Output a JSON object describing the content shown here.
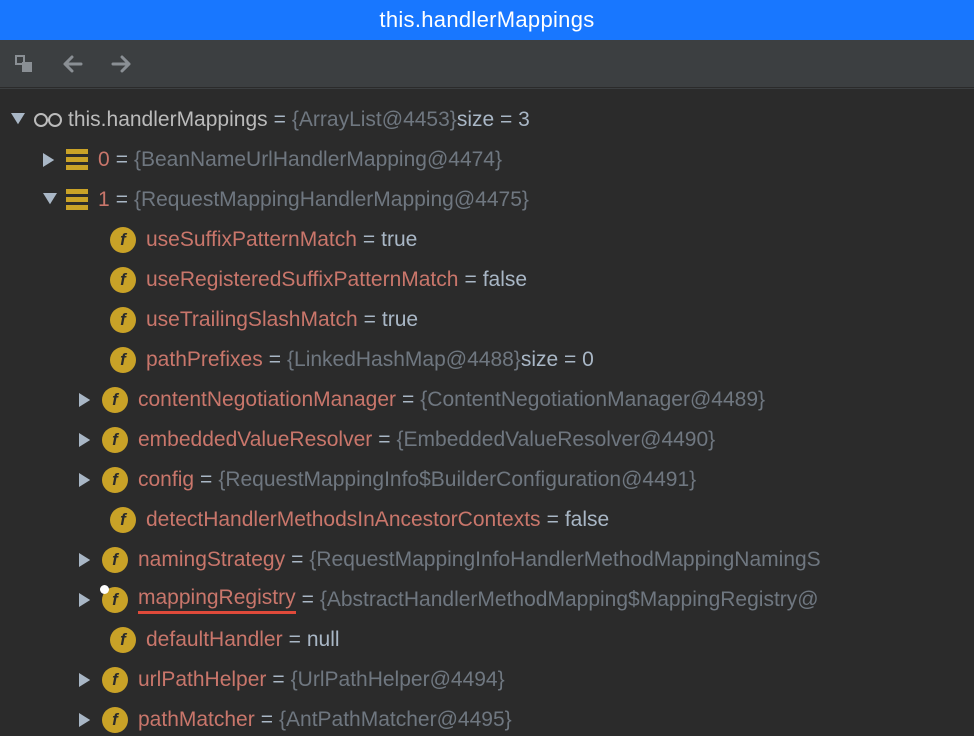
{
  "titlebar": {
    "title": "this.handlerMappings"
  },
  "root": {
    "label": "this.handlerMappings",
    "eq": " = ",
    "value": "{ArrayList@4453} ",
    "extra": " size = 3"
  },
  "items": {
    "i0": {
      "key": "0",
      "eq": " = ",
      "value": "{BeanNameUrlHandlerMapping@4474}"
    },
    "i1": {
      "key": "1",
      "eq": " = ",
      "value": "{RequestMappingHandlerMapping@4475}"
    }
  },
  "fields": {
    "useSuffixPatternMatch": {
      "key": "useSuffixPatternMatch",
      "eq": " = ",
      "value": "true"
    },
    "useRegisteredSuffixPatternMatch": {
      "key": "useRegisteredSuffixPatternMatch",
      "eq": " = ",
      "value": "false"
    },
    "useTrailingSlashMatch": {
      "key": "useTrailingSlashMatch",
      "eq": " = ",
      "value": "true"
    },
    "pathPrefixes": {
      "key": "pathPrefixes",
      "eq": " = ",
      "value": "{LinkedHashMap@4488} ",
      "extra": " size = 0"
    },
    "contentNegotiationManager": {
      "key": "contentNegotiationManager",
      "eq": " = ",
      "value": "{ContentNegotiationManager@4489}"
    },
    "embeddedValueResolver": {
      "key": "embeddedValueResolver",
      "eq": " = ",
      "value": "{EmbeddedValueResolver@4490}"
    },
    "config": {
      "key": "config",
      "eq": " = ",
      "value": "{RequestMappingInfo$BuilderConfiguration@4491}"
    },
    "detectHandlerMethodsInAncestorContexts": {
      "key": "detectHandlerMethodsInAncestorContexts",
      "eq": " = ",
      "value": "false"
    },
    "namingStrategy": {
      "key": "namingStrategy",
      "eq": " = ",
      "value": "{RequestMappingInfoHandlerMethodMappingNamingS"
    },
    "mappingRegistry": {
      "key": "mappingRegistry",
      "eq": " = ",
      "value": "{AbstractHandlerMethodMapping$MappingRegistry@"
    },
    "defaultHandler": {
      "key": "defaultHandler",
      "eq": " = ",
      "value": "null"
    },
    "urlPathHelper": {
      "key": "urlPathHelper",
      "eq": " = ",
      "value": "{UrlPathHelper@4494}"
    },
    "pathMatcher": {
      "key": "pathMatcher",
      "eq": " = ",
      "value": "{AntPathMatcher@4495}"
    }
  }
}
